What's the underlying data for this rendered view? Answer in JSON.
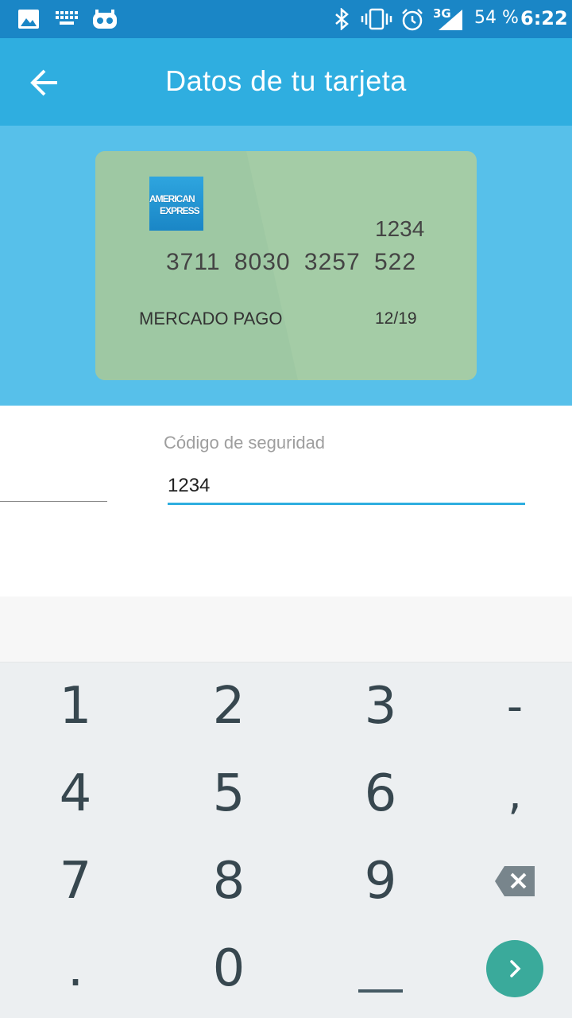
{
  "status_bar": {
    "network": "3G",
    "battery": "54 %",
    "time": "6:22",
    "icons": [
      "image-icon",
      "keyboard-icon",
      "cyanogen-icon",
      "bluetooth-icon",
      "vibrate-icon",
      "alarm-icon",
      "signal-icon"
    ]
  },
  "toolbar": {
    "title": "Datos de tu tarjeta",
    "back_icon": "arrow-back-icon"
  },
  "card": {
    "brand": "American Express",
    "logo_line1": "AMERICAN",
    "logo_line2": "EXPRESS",
    "security_code": "1234",
    "number": "3711 8030 3257 522",
    "holder": "MERCADO PAGO",
    "expiry": "12/19",
    "background_color": "#a4cca6"
  },
  "form": {
    "security_label": "Código de seguridad",
    "security_value": "1234",
    "accent_color": "#2faee0"
  },
  "keyboard": {
    "rows": [
      [
        "1",
        "2",
        "3",
        "-"
      ],
      [
        "4",
        "5",
        "6",
        ","
      ],
      [
        "7",
        "8",
        "9",
        "⌫"
      ],
      [
        ".",
        "0",
        "_",
        "›"
      ]
    ],
    "action_color": "#3aaa9b"
  }
}
